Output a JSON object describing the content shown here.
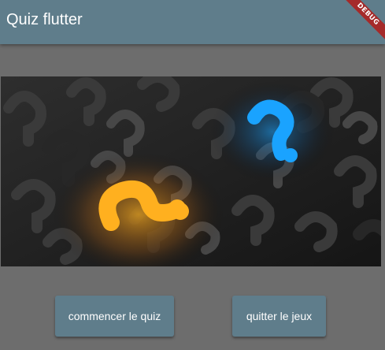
{
  "appbar": {
    "title": "Quiz flutter",
    "debug_banner": "DEBUG"
  },
  "hero_image": {
    "icon": "question-marks-image"
  },
  "actions": {
    "start_label": "commencer le quiz",
    "quit_label": "quitter le jeux"
  },
  "colors": {
    "appbar": "#5f7d8b",
    "background": "#616161",
    "card": "#6d6d6d",
    "button": "#5f7d8b",
    "debug_ribbon": "#a52a2a",
    "accent_orange": "#ffb01f",
    "accent_blue": "#1aa3ff"
  }
}
